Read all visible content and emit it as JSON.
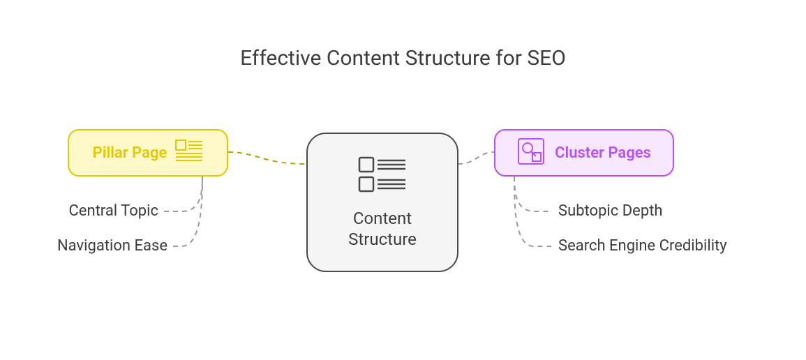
{
  "title": "Effective Content Structure for SEO",
  "central": {
    "label": "Content\nStructure"
  },
  "pillar": {
    "label": "Pillar Page",
    "items": [
      "Central Topic",
      "Navigation Ease"
    ]
  },
  "cluster": {
    "label": "Cluster Pages",
    "items": [
      "Subtopic Depth",
      "Search Engine Credibility"
    ]
  },
  "colors": {
    "pillar": "#e3c900",
    "pillar_bg": "#fff8c8",
    "cluster": "#b94eff",
    "cluster_bg": "#f7e8ff",
    "central_border": "#4a4a4a",
    "central_bg": "#f5f5f5",
    "text": "#3d3d3d"
  }
}
